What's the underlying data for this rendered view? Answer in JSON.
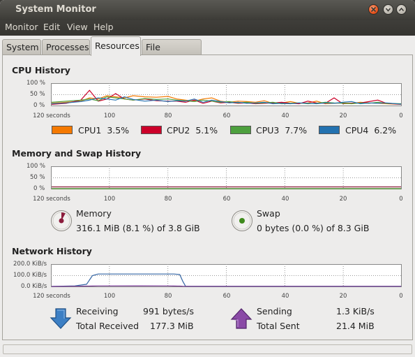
{
  "window": {
    "title": "System Monitor"
  },
  "menu": [
    "Monitor",
    "Edit",
    "View",
    "Help"
  ],
  "tabs": [
    "System",
    "Processes",
    "Resources",
    "File Systems"
  ],
  "active_tab": "Resources",
  "colors": {
    "cpu1": "#f57900",
    "cpu2": "#cc0029",
    "cpu3": "#4da03e",
    "cpu4": "#2372b0",
    "memory": "#8b1c3c",
    "swap": "#3f8a1c",
    "receiving": "#3465a4",
    "sending": "#7c3d98"
  },
  "cpu": {
    "title": "CPU History",
    "y_ticks": [
      "100 %",
      "50 %",
      "0 %"
    ],
    "x_ticks": [
      "120 seconds",
      "100",
      "80",
      "60",
      "40",
      "20",
      "0"
    ],
    "legend": [
      {
        "name": "CPU1",
        "value": "3.5%"
      },
      {
        "name": "CPU2",
        "value": "5.1%"
      },
      {
        "name": "CPU3",
        "value": "7.7%"
      },
      {
        "name": "CPU4",
        "value": "6.2%"
      }
    ]
  },
  "memory": {
    "title": "Memory and Swap History",
    "y_ticks": [
      "100 %",
      "50 %",
      "0 %"
    ],
    "x_ticks": [
      "120 seconds",
      "100",
      "80",
      "60",
      "40",
      "20",
      "0"
    ],
    "memory_label": "Memory",
    "memory_value": "316.1 MiB (8.1 %) of 3.8 GiB",
    "swap_label": "Swap",
    "swap_value": "0 bytes (0.0 %) of 8.3 GiB"
  },
  "network": {
    "title": "Network History",
    "y_ticks": [
      "200.0 KiB/s",
      "100.0 KiB/s",
      "0.0 KiB/s"
    ],
    "x_ticks": [
      "120 seconds",
      "100",
      "80",
      "60",
      "40",
      "20",
      "0"
    ],
    "receiving_label": "Receiving",
    "receiving_value": "991 bytes/s",
    "total_received_label": "Total Received",
    "total_received_value": "177.3 MiB",
    "sending_label": "Sending",
    "sending_value": "1.3 KiB/s",
    "total_sent_label": "Total Sent",
    "total_sent_value": "21.4 MiB"
  },
  "chart_data": [
    {
      "type": "line",
      "title": "CPU History",
      "xlabel": "",
      "ylabel": "",
      "x": [
        120,
        115,
        110,
        107,
        104,
        101,
        98,
        95,
        92,
        88,
        84,
        80,
        77,
        74,
        71,
        68,
        65,
        62,
        59,
        56,
        53,
        50,
        47,
        44,
        41,
        38,
        35,
        32,
        29,
        26,
        23,
        20,
        17,
        14,
        11,
        8,
        5,
        0
      ],
      "xlim": [
        120,
        0
      ],
      "ylim": [
        0,
        100
      ],
      "series": [
        {
          "name": "CPU1",
          "values": [
            10,
            15,
            20,
            35,
            30,
            45,
            40,
            35,
            45,
            40,
            38,
            42,
            30,
            25,
            20,
            30,
            35,
            20,
            15,
            20,
            18,
            15,
            22,
            10,
            12,
            18,
            10,
            12,
            20,
            8,
            10,
            12,
            10,
            15,
            12,
            10,
            8,
            5
          ]
        },
        {
          "name": "CPU2",
          "values": [
            5,
            10,
            25,
            70,
            20,
            30,
            55,
            30,
            25,
            30,
            22,
            20,
            20,
            15,
            25,
            10,
            20,
            12,
            15,
            10,
            12,
            8,
            10,
            12,
            15,
            10,
            8,
            20,
            12,
            10,
            35,
            8,
            10,
            12,
            18,
            25,
            10,
            5
          ]
        },
        {
          "name": "CPU3",
          "values": [
            15,
            20,
            25,
            30,
            22,
            40,
            35,
            30,
            25,
            32,
            28,
            30,
            25,
            22,
            18,
            25,
            20,
            15,
            18,
            12,
            15,
            10,
            12,
            15,
            8,
            10,
            12,
            8,
            10,
            15,
            12,
            10,
            8,
            12,
            10,
            15,
            10,
            8
          ]
        },
        {
          "name": "CPU4",
          "values": [
            8,
            12,
            18,
            25,
            35,
            30,
            25,
            40,
            28,
            20,
            25,
            18,
            22,
            20,
            30,
            15,
            25,
            18,
            12,
            15,
            10,
            12,
            15,
            8,
            10,
            8,
            12,
            10,
            8,
            12,
            10,
            15,
            18,
            8,
            12,
            10,
            12,
            6
          ]
        }
      ]
    },
    {
      "type": "line",
      "title": "Memory and Swap History",
      "xlim": [
        120,
        0
      ],
      "ylim": [
        0,
        100
      ],
      "x": [
        120,
        0
      ],
      "series": [
        {
          "name": "Memory",
          "values": [
            8.1,
            8.1
          ]
        },
        {
          "name": "Swap",
          "values": [
            0,
            0
          ]
        }
      ]
    },
    {
      "type": "line",
      "title": "Network History",
      "xlim": [
        120,
        0
      ],
      "ylim": [
        0,
        200
      ],
      "x": [
        120,
        112,
        108,
        106,
        104,
        90,
        80,
        78,
        76,
        75,
        74,
        60,
        40,
        20,
        0
      ],
      "series": [
        {
          "name": "Receiving",
          "values": [
            0,
            5,
            20,
            100,
            115,
            115,
            115,
            115,
            110,
            50,
            1,
            1,
            1,
            1,
            1
          ]
        },
        {
          "name": "Sending",
          "values": [
            0,
            2,
            3,
            4,
            5,
            6,
            5,
            4,
            3,
            2,
            1.3,
            1.3,
            1.3,
            1.3,
            1.3
          ]
        }
      ]
    }
  ]
}
